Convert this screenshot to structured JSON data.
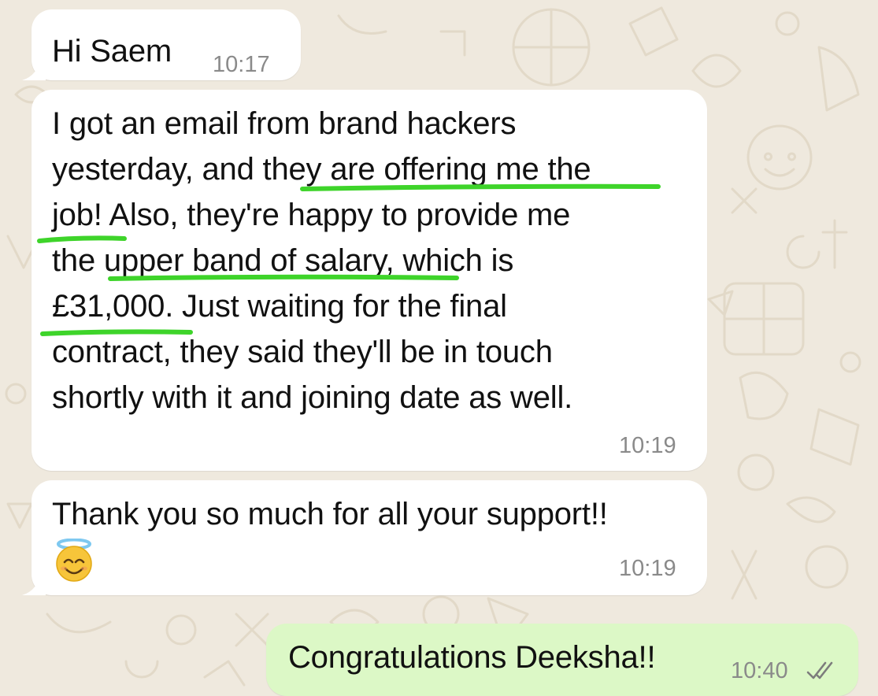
{
  "chat": {
    "messages": [
      {
        "direction": "incoming",
        "text": "Hi Saem",
        "time": "10:17"
      },
      {
        "direction": "incoming",
        "lines": [
          "I got an email from brand hackers",
          "yesterday, and they are  offering me the",
          "job! Also, they're happy to provide me",
          "the upper band of salary, which is",
          "£31,000. Just waiting for the final",
          "contract, they said they'll be in touch",
          "shortly with it and joining date as well."
        ],
        "time": "10:19"
      },
      {
        "direction": "incoming",
        "text": "Thank you so much for all your support!!",
        "emoji": "smiling-face-with-halo",
        "time": "10:19"
      },
      {
        "direction": "outgoing",
        "text": "Congratulations Deeksha!!",
        "time": "10:40",
        "status": "read-double-check"
      }
    ]
  },
  "colors": {
    "wallpaper": "#efe9de",
    "incoming_bubble": "#ffffff",
    "outgoing_bubble": "#dcf8c6",
    "highlight_marker": "#3ed42a",
    "time_text": "#8a8a8a"
  }
}
